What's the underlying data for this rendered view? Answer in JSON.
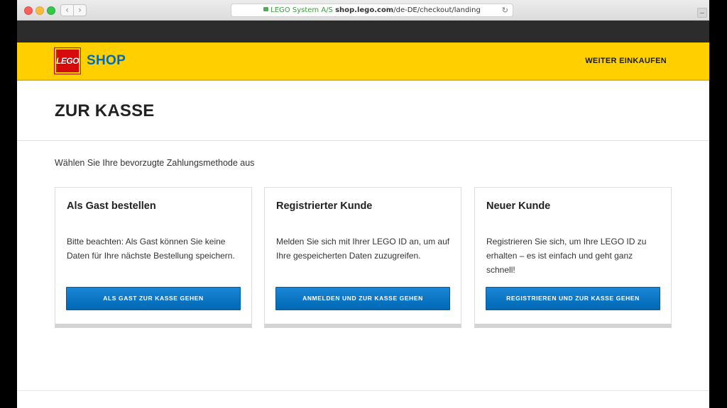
{
  "browser": {
    "url_cert": "LEGO System A/S",
    "url_domain": "shop.lego.com",
    "url_path": "/de-DE/checkout/landing",
    "back_glyph": "‹",
    "forward_glyph": "›",
    "reload_glyph": "↻"
  },
  "header": {
    "logo_text": "LEGO",
    "shop_label": "SHOP",
    "continue_shopping": "WEITER EINKAUFEN"
  },
  "page": {
    "title": "ZUR KASSE",
    "instruction": "Wählen Sie Ihre bevorzugte Zahlungsmethode aus"
  },
  "options": [
    {
      "title": "Als Gast bestellen",
      "description": "Bitte beachten: Als Gast können Sie keine Daten für Ihre nächste Bestellung speichern.",
      "button": "ALS GAST ZUR KASSE GEHEN"
    },
    {
      "title": "Registrierter Kunde",
      "description": "Melden Sie sich mit Ihrer LEGO ID an, um auf Ihre gespeicherten Daten zuzugreifen.",
      "button": "ANMELDEN UND ZUR KASSE GEHEN"
    },
    {
      "title": "Neuer Kunde",
      "description": "Registrieren Sie sich, um Ihre LEGO ID zu erhalten – es ist einfach und geht ganz schnell!",
      "button": "REGISTRIEREN UND ZUR KASSE GEHEN"
    }
  ],
  "colors": {
    "header_yellow": "#ffcf00",
    "brand_blue": "#006cb7",
    "logo_red": "#d60b0b",
    "button_blue": "#0a78c8"
  }
}
